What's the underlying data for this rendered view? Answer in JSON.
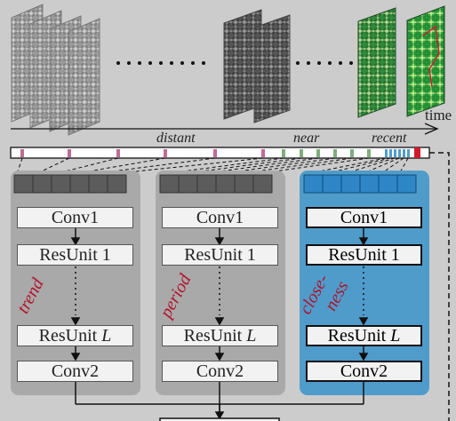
{
  "timeline": {
    "axis_label": "time",
    "segment_labels": {
      "distant": "distant",
      "near": "near",
      "recent": "recent"
    }
  },
  "branches": {
    "trend": {
      "tag": "trend",
      "layers": [
        "Conv1",
        "ResUnit 1",
        "ResUnit ",
        "Conv2"
      ],
      "L": "L"
    },
    "period": {
      "tag": "period",
      "layers": [
        "Conv1",
        "ResUnit 1",
        "ResUnit ",
        "Conv2"
      ],
      "L": "L"
    },
    "closeness": {
      "tag_line1": "close-",
      "tag_line2": "ness",
      "layers": [
        "Conv1",
        "ResUnit 1",
        "ResUnit ",
        "Conv2"
      ],
      "L": "L"
    }
  },
  "colors": {
    "background": "#cccccc",
    "gray_branch": "#a9a9a9",
    "blue_branch": "#4f9ccb",
    "red": "#b3122b",
    "pink_tick": "#c06a98",
    "green_tick": "#7fae7e",
    "blue_tick": "#4f9ccb"
  }
}
